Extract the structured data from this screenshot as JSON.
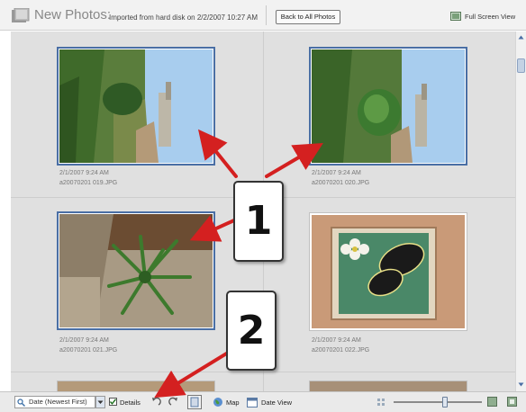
{
  "header": {
    "title": "New Photos:",
    "subtitle": "Imported from hard disk on 2/2/2007 10:27 AM",
    "back_label": "Back to All Photos",
    "fullscreen_label": "Full Screen View",
    "folder_icon": "folder-icon",
    "fullscreen_icon": "fullscreen-icon"
  },
  "photos": [
    {
      "date": "2/1/2007 9:24 AM",
      "filename": "a20070201 019.JPG",
      "selected": true,
      "scene": "garden-tower"
    },
    {
      "date": "2/1/2007 9:24 AM",
      "filename": "a20070201 020.JPG",
      "selected": true,
      "scene": "garden-tower"
    },
    {
      "date": "2/1/2007 9:24 AM",
      "filename": "a20070201 021.JPG",
      "selected": true,
      "scene": "agave-plant"
    },
    {
      "date": "2/1/2007 9:24 AM",
      "filename": "a20070201 022.JPG",
      "selected": false,
      "scene": "butterfly-tile"
    }
  ],
  "toolbar": {
    "sort_value": "Date (Newest First)",
    "details_label": "Details",
    "details_checked": true,
    "map_label": "Map",
    "date_view_label": "Date View",
    "zoom_level": 0.58
  },
  "callouts": [
    {
      "label": "1"
    },
    {
      "label": "2"
    }
  ],
  "colors": {
    "selection_border": "#4a6fa5",
    "arrow": "#d42020"
  }
}
